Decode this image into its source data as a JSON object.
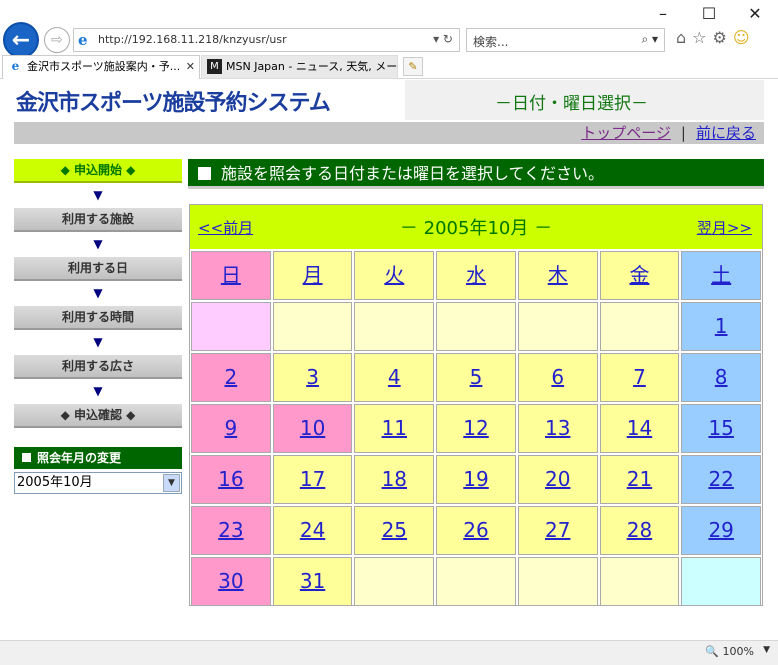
{
  "browser": {
    "url": "http://192.168.11.218/knzyusr/usr",
    "search_placeholder": "検索...",
    "tabs": [
      {
        "title": "金沢市スポーツ施設案内・予...",
        "active": true
      },
      {
        "title": "MSN Japan - ニュース, 天気, メー...",
        "active": false
      }
    ],
    "zoom": "100%"
  },
  "header": {
    "logo": "金沢市スポーツ施設予約システム",
    "subtitle": "－日付・曜日選択－",
    "link_top": "トップページ",
    "link_separator": "|",
    "link_back": "前に戻る"
  },
  "nav": {
    "steps": [
      {
        "label": "◆ 申込開始 ◆",
        "current": true
      },
      {
        "label": "利用する施設",
        "current": false
      },
      {
        "label": "利用する日",
        "current": false
      },
      {
        "label": "利用する時間",
        "current": false
      },
      {
        "label": "利用する広さ",
        "current": false
      },
      {
        "label": "◆ 申込確認 ◆",
        "current": false
      }
    ],
    "arrow": "▼",
    "change_title": "照会年月の変更",
    "month_select_value": "2005年10月"
  },
  "main": {
    "instruction": "施設を照会する日付または曜日を選択してください。"
  },
  "calendar": {
    "prev_label": "<<前月",
    "month_label": "－ 2005年10月 －",
    "next_label": "翌月>>",
    "weekdays": [
      "日",
      "月",
      "火",
      "水",
      "木",
      "金",
      "土"
    ],
    "weeks": [
      [
        "",
        "",
        "",
        "",
        "",
        "",
        "1"
      ],
      [
        "2",
        "3",
        "4",
        "5",
        "6",
        "7",
        "8"
      ],
      [
        "9",
        "10",
        "11",
        "12",
        "13",
        "14",
        "15"
      ],
      [
        "16",
        "17",
        "18",
        "19",
        "20",
        "21",
        "22"
      ],
      [
        "23",
        "24",
        "25",
        "26",
        "27",
        "28",
        "29"
      ],
      [
        "30",
        "31",
        "",
        "",
        "",
        "",
        ""
      ]
    ],
    "holidays": [
      "10"
    ],
    "colors": {
      "sunday": "#ff99cc",
      "weekday": "#ffff99",
      "saturday": "#99ccff",
      "header_bar": "#ccff00",
      "title_bar": "#006600"
    }
  }
}
